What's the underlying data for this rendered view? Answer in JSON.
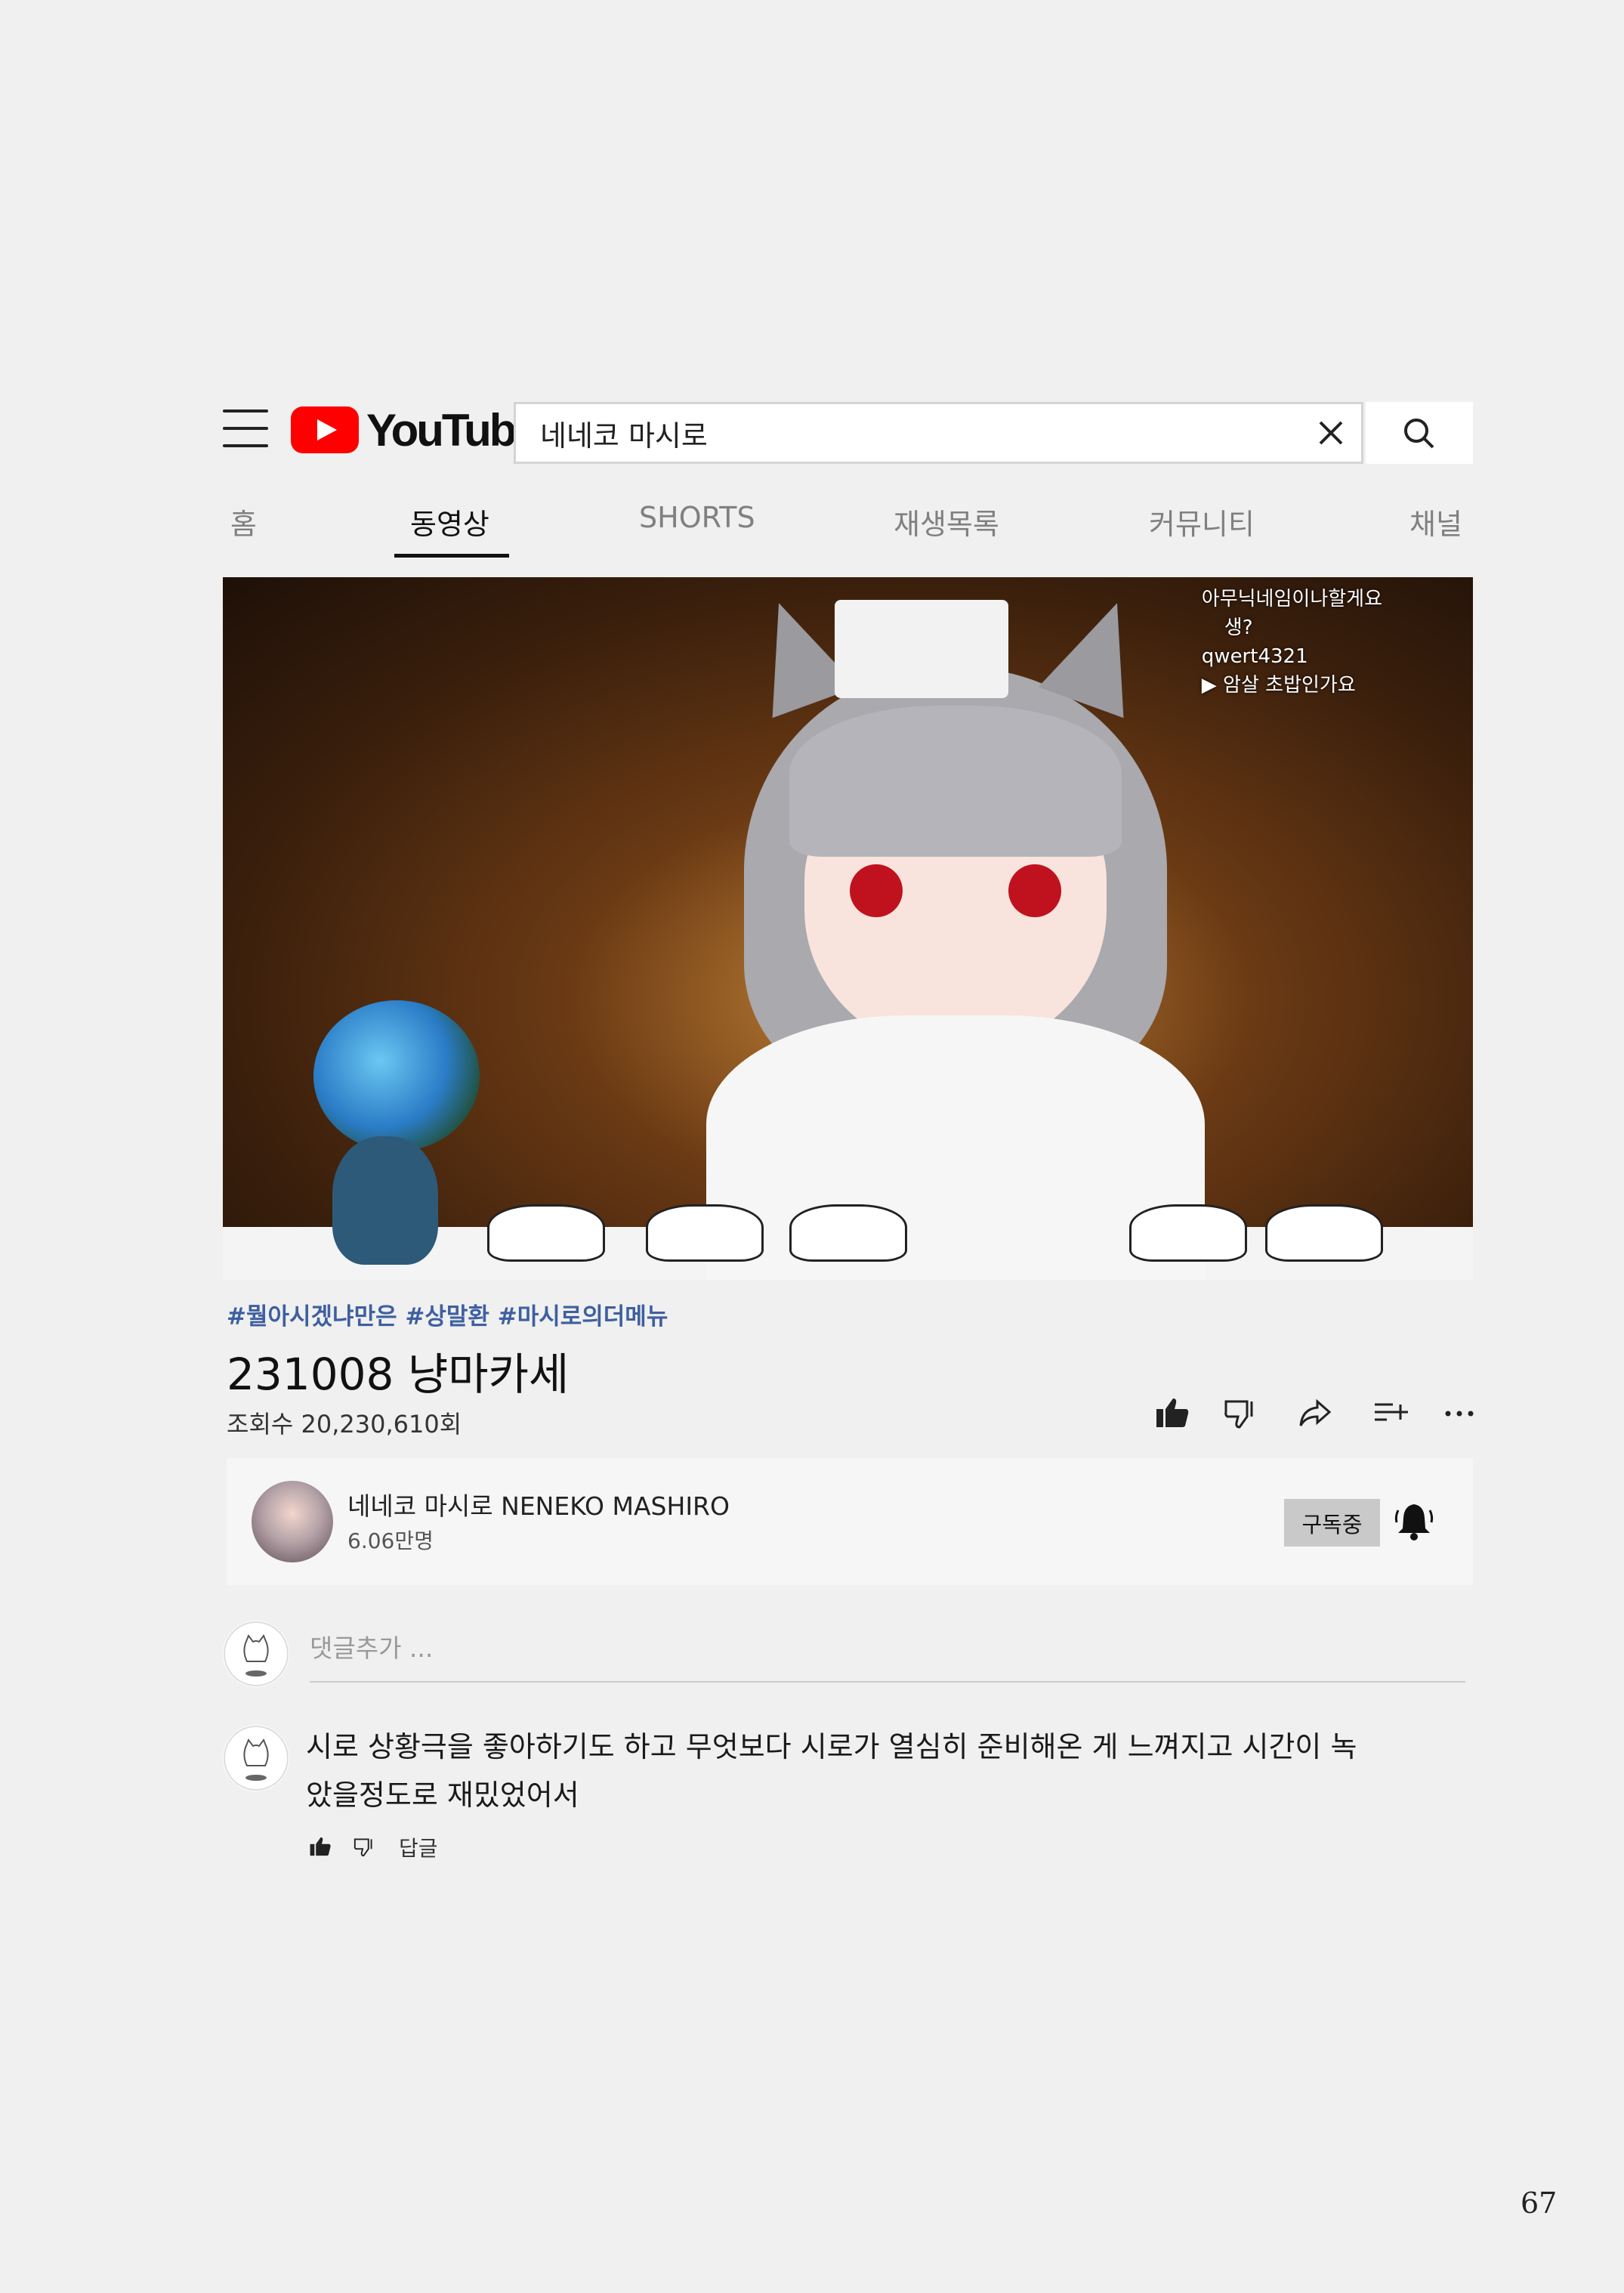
{
  "header": {
    "logo_text": "YouTube",
    "search_value": "네네코 마시로"
  },
  "tabs": [
    {
      "label": "홈"
    },
    {
      "label": "동영상"
    },
    {
      "label": "SHORTS"
    },
    {
      "label": "재생목록"
    },
    {
      "label": "커뮤니티"
    },
    {
      "label": "채널"
    }
  ],
  "video": {
    "chat_lines": [
      "아무닉네임이나할게요",
      "생?",
      "qwert4321",
      "▶ 암살 초밥인가요"
    ],
    "hashtags": "#뭘아시겠냐만은 #상말환 #마시로의더메뉴",
    "title": "231008 냥마카세",
    "views": "조회수 20,230,610회"
  },
  "channel": {
    "name": "네네코 마시로 NENEKO MASHIRO",
    "subscribers": "6.06만명",
    "subscribe_label": "구독중"
  },
  "comments": {
    "placeholder": "댓글추가 ...",
    "items": [
      {
        "text": "시로 상황극을 좋아하기도 하고 무엇보다 시로가 열심히 준비해온 게 느껴지고 시간이 녹았을정도로 재밌었어서",
        "reply_label": "답글"
      }
    ]
  },
  "page_number": "67"
}
